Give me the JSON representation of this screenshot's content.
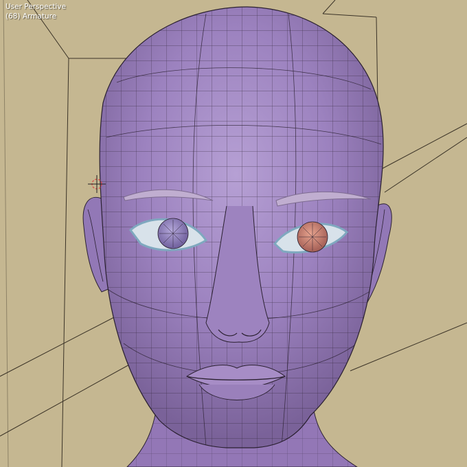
{
  "viewport": {
    "view_name": "User Perspective",
    "object_info": "(68) Armature"
  },
  "colors": {
    "background": "#c5b791",
    "mesh_fill": "#9e84be",
    "wire": "#2a2030",
    "eye_left": "#9a8ac4",
    "eye_right": "#d48a7a",
    "lashes": "#8fb4c8",
    "brows": "#b8a4c4"
  }
}
